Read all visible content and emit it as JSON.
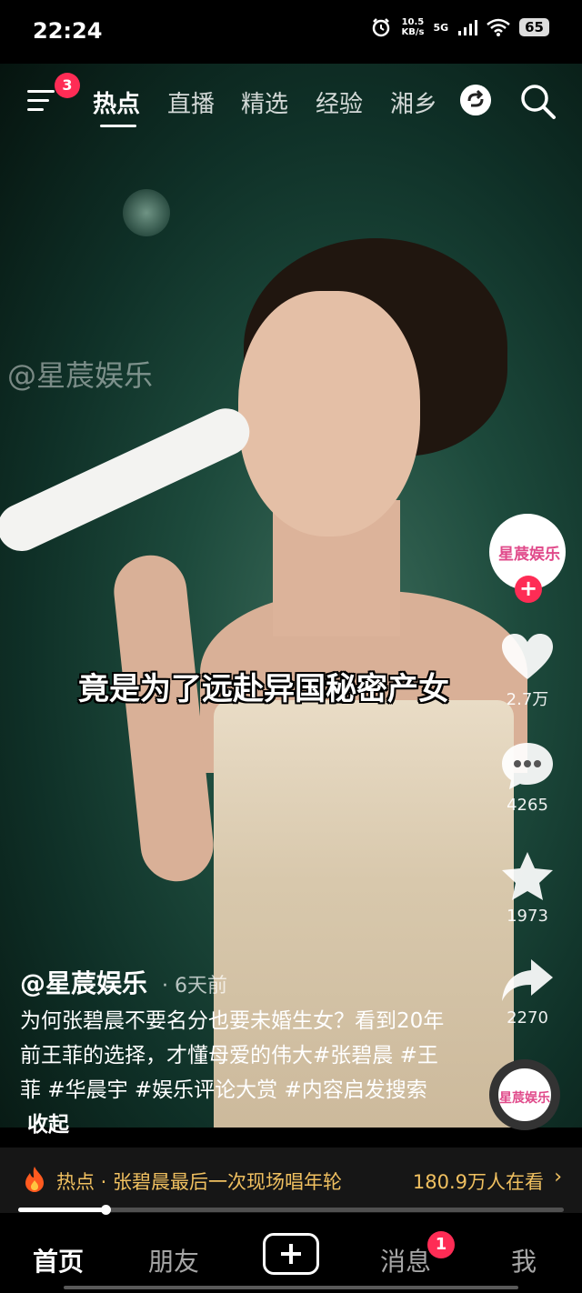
{
  "status": {
    "time": "22:24",
    "speed_value": "10.5",
    "speed_unit": "KB/s",
    "network": "5G",
    "battery": "65"
  },
  "top_nav": {
    "menu_badge": "3",
    "tabs": [
      {
        "label": "热点",
        "active": true
      },
      {
        "label": "直播"
      },
      {
        "label": "精选"
      },
      {
        "label": "经验"
      },
      {
        "label": "湘乡"
      }
    ]
  },
  "video": {
    "watermark": "@星莀娱乐",
    "subtitle": "竟是为了远赴异国秘密产女"
  },
  "side_rail": {
    "avatar_text": "星莀娱乐",
    "follow_symbol": "+",
    "likes": "2.7万",
    "comments": "4265",
    "favorites": "1973",
    "shares": "2270",
    "music_text": "星莀娱乐"
  },
  "post": {
    "author": "@星莀娱乐",
    "time_ago": "· 6天前",
    "description": "为何张碧晨不要名分也要未婚生女？看到20年前王菲的选择，才懂母爱的伟大#张碧晨 #王菲 #华晨宇 #娱乐评论大赏 #内容启发搜索",
    "collapse_label": "收起"
  },
  "hot_bar": {
    "text": "热点 · 张碧晨最后一次现场唱年轮",
    "viewers": "180.9万人在看",
    "arrow": "›"
  },
  "progress": 0.16,
  "bottom_nav": {
    "home": "首页",
    "friends": "朋友",
    "messages": "消息",
    "messages_badge": "1",
    "me": "我"
  },
  "colors": {
    "accent": "#fe2c55",
    "hot_text": "#f0c060",
    "background": "#000000"
  }
}
